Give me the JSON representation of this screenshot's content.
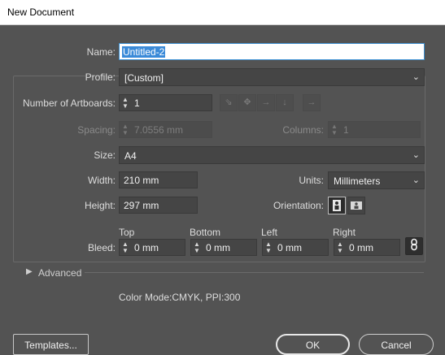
{
  "window": {
    "title": "New Document"
  },
  "name": {
    "label": "Name:",
    "value": "Untitled-2"
  },
  "profile": {
    "label": "Profile:",
    "value": "[Custom]"
  },
  "artboards": {
    "label": "Number of Artboards:",
    "value": "1"
  },
  "spacing": {
    "label": "Spacing:",
    "value": "7.0556 mm"
  },
  "columns": {
    "label": "Columns:",
    "value": "1"
  },
  "size": {
    "label": "Size:",
    "value": "A4"
  },
  "width": {
    "label": "Width:",
    "value": "210 mm"
  },
  "units": {
    "label": "Units:",
    "value": "Millimeters"
  },
  "height": {
    "label": "Height:",
    "value": "297 mm"
  },
  "orientation": {
    "label": "Orientation:",
    "selected": "portrait"
  },
  "bleed": {
    "label": "Bleed:",
    "top": {
      "label": "Top",
      "value": "0 mm"
    },
    "bottom": {
      "label": "Bottom",
      "value": "0 mm"
    },
    "left": {
      "label": "Left",
      "value": "0 mm"
    },
    "right": {
      "label": "Right",
      "value": "0 mm"
    }
  },
  "advanced": {
    "label": "Advanced"
  },
  "info": {
    "text": "Color Mode:CMYK, PPI:300"
  },
  "buttons": {
    "templates": "Templates...",
    "ok": "OK",
    "cancel": "Cancel"
  },
  "icons": [
    "grid-by-row-icon",
    "grid-by-column-icon",
    "arrange-by-row-icon",
    "arrange-by-column-icon",
    "right-to-left-icon",
    "portrait-icon",
    "landscape-icon",
    "chain-link-icon"
  ]
}
